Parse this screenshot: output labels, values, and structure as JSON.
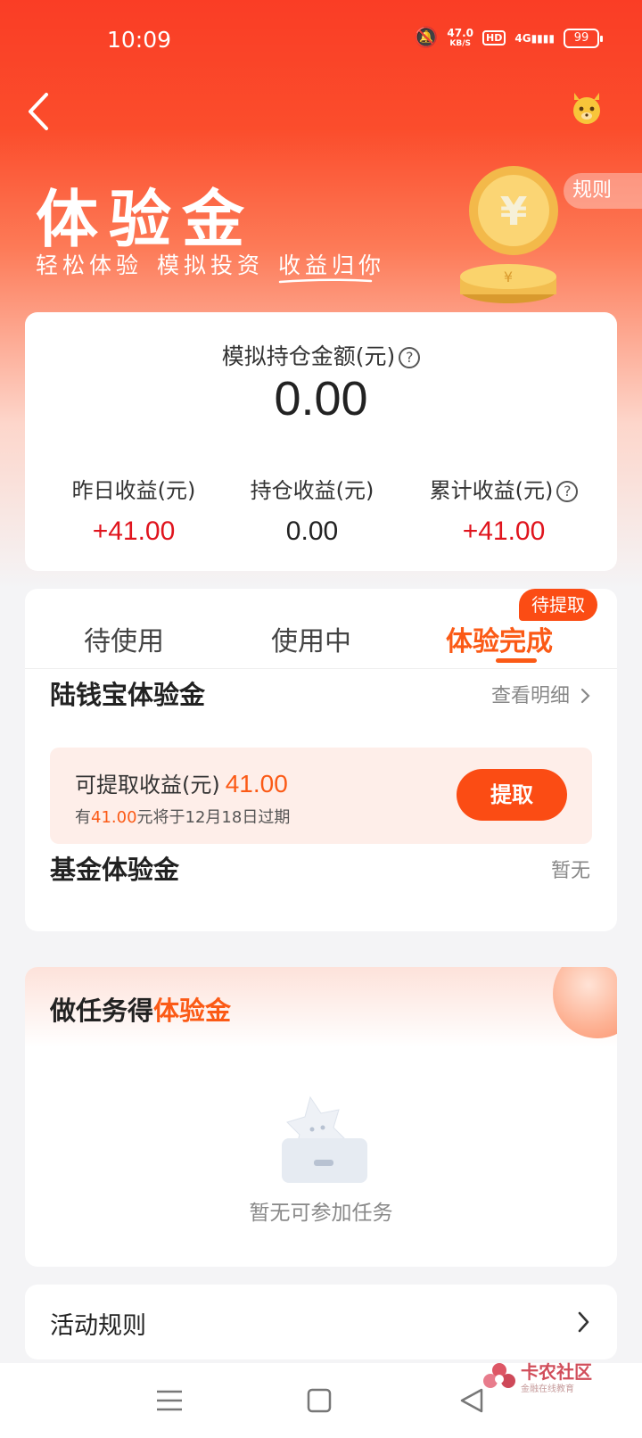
{
  "status_bar": {
    "time": "10:09",
    "net_speed_value": "47.0",
    "net_speed_unit": "KB/S",
    "hd": "HD",
    "signal": "4G",
    "battery": "99"
  },
  "header": {
    "title": "体验金",
    "slogan": [
      "轻松体验",
      "模拟投资",
      "收益归你"
    ],
    "rules_tag": "规则"
  },
  "summary": {
    "holding_label": "模拟持仓金额(元)",
    "holding_value": "0.00",
    "stats": [
      {
        "label": "昨日收益(元)",
        "value": "+41.00"
      },
      {
        "label": "持仓收益(元)",
        "value": "0.00"
      },
      {
        "label": "累计收益(元)",
        "value": "+41.00"
      }
    ]
  },
  "tabs": {
    "items": [
      "待使用",
      "使用中",
      "体验完成"
    ],
    "active_index": 2,
    "badge": "待提取"
  },
  "luqianbao": {
    "title": "陆钱宝体验金",
    "detail_link": "查看明细",
    "redeem_label": "可提取收益(元)",
    "redeem_amount": "41.00",
    "note_prefix": "有",
    "note_amount": "41.00",
    "note_suffix": "元将于12月18日过期",
    "redeem_button": "提取"
  },
  "fund": {
    "title": "基金体验金",
    "status": "暂无"
  },
  "tasks": {
    "title_prefix": "做任务得",
    "title_highlight": "体验金",
    "empty_text": "暂无可参加任务"
  },
  "rules_row": {
    "label": "活动规则"
  },
  "watermark": {
    "name": "卡农社区",
    "sub": "金融在线教育"
  },
  "colors": {
    "brand_orange": "#fb4c14",
    "gain_red": "#e0141d",
    "header_red": "#fa3d25"
  }
}
